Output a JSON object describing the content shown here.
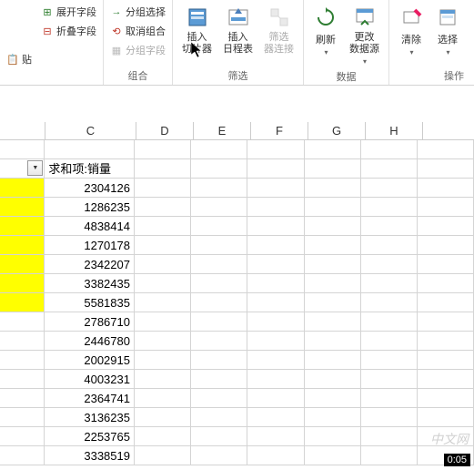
{
  "ribbon": {
    "group1": {
      "paste_btn": "贴",
      "items": [
        "展开字段",
        "折叠字段"
      ]
    },
    "group2": {
      "label": "组合",
      "items": [
        "分组选择",
        "取消组合",
        "分组字段"
      ]
    },
    "group3": {
      "label": "筛选",
      "slicer": "插入\n切片器",
      "timeline": "插入\n日程表",
      "filter_conn": "筛选\n器连接"
    },
    "group4": {
      "label": "数据",
      "refresh": "刷新",
      "change_src": "更改\n数据源"
    },
    "group5": {
      "clear": "清除",
      "select": "选择"
    },
    "group6_label": "操作"
  },
  "columns": [
    "C",
    "D",
    "E",
    "F",
    "G",
    "H"
  ],
  "pivot_header": "求和项:销量",
  "chart_data": {
    "type": "table",
    "title": "求和项:销量",
    "values": [
      2304126,
      1286235,
      4838414,
      1270178,
      2342207,
      3382435,
      5581835,
      2786710,
      2446780,
      2002915,
      4003231,
      2364741,
      3136235,
      2253765,
      3338519
    ]
  },
  "yellow_rows": 7,
  "watermark": "中文网",
  "video_time": "0:05"
}
